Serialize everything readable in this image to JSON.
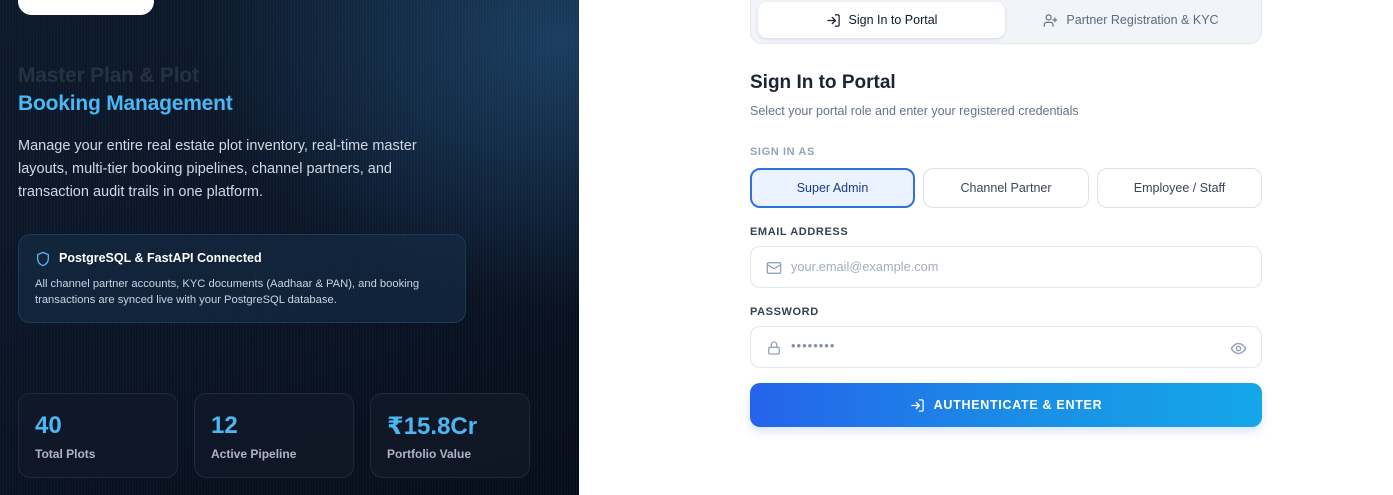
{
  "hero": {
    "title_line1": "Master Plan & Plot",
    "title_line2": "Booking Management",
    "description": "Manage your entire real estate plot inventory, real-time master layouts, multi-tier booking pipelines, channel partners, and transaction audit trails in one platform."
  },
  "db_status": {
    "title": "PostgreSQL & FastAPI Connected",
    "body": "All channel partner accounts, KYC documents (Aadhaar & PAN), and booking transactions are synced live with your PostgreSQL database."
  },
  "stats": [
    {
      "value": "40",
      "label": "Total Plots"
    },
    {
      "value": "12",
      "label": "Active Pipeline"
    },
    {
      "value": "₹15.8Cr",
      "label": "Portfolio Value"
    }
  ],
  "tabs": [
    {
      "label": "Sign In to Portal",
      "active": true
    },
    {
      "label": "Partner Registration & KYC",
      "active": false
    }
  ],
  "form": {
    "title": "Sign In to Portal",
    "subtitle": "Select your portal role and enter your registered credentials",
    "role_label": "SIGN IN AS",
    "roles": [
      "Super Admin",
      "Channel Partner",
      "Employee / Staff"
    ],
    "selected_role": "Super Admin",
    "email_label": "EMAIL ADDRESS",
    "email_placeholder": "your.email@example.com",
    "password_label": "PASSWORD",
    "password_value": "••••••••",
    "submit_label": "AUTHENTICATE & ENTER"
  },
  "colors": {
    "accent": "#4cb7f2",
    "primary_button_start": "#2563eb",
    "primary_button_end": "#14a7e8",
    "selected_role_border": "#2f6fe0"
  },
  "icons": {
    "tab_signin": "log-in-icon",
    "tab_register": "user-plus-icon",
    "status": "shield-icon",
    "email": "mail-icon",
    "password": "lock-icon",
    "toggle_password": "eye-icon",
    "submit": "log-in-icon"
  }
}
